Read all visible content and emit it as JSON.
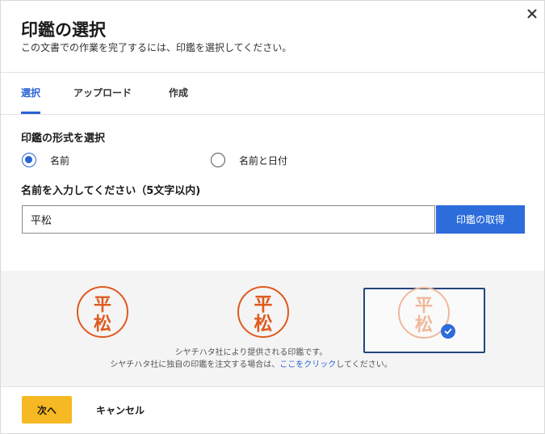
{
  "dialog": {
    "title": "印鑑の選択",
    "subtitle": "この文書での作業を完了するには、印鑑を選択してください。",
    "close_icon": "close-icon"
  },
  "tabs": [
    {
      "label": "選択",
      "active": true
    },
    {
      "label": "アップロード",
      "active": false
    },
    {
      "label": "作成",
      "active": false
    }
  ],
  "format": {
    "label": "印鑑の形式を選択",
    "options": [
      {
        "label": "名前",
        "checked": true
      },
      {
        "label": "名前と日付",
        "checked": false
      }
    ]
  },
  "name_input": {
    "label": "名前を入力してください（5文字以内)",
    "value": "平松",
    "button_label": "印鑑の取得"
  },
  "seals": [
    {
      "line1": "平",
      "line2": "松",
      "style": "round"
    },
    {
      "line1": "平",
      "line2": "松",
      "style": "round-decorative"
    },
    {
      "line1": "平",
      "line2": "松",
      "style": "round-selected",
      "selected": true
    }
  ],
  "info": {
    "line1": "シヤチハタ社により提供される印鑑です。",
    "line2_prefix": "シヤチハタ社に独自の印鑑を注文する場合は、",
    "line2_link": "ここをクリック",
    "line2_suffix": "してください。"
  },
  "footer": {
    "next_label": "次へ",
    "cancel_label": "キャンセル"
  },
  "colors": {
    "accent": "#2a63d4",
    "seal_red": "#e05a1e",
    "seal_faded": "#f0b89a",
    "next_button": "#f6b823"
  }
}
